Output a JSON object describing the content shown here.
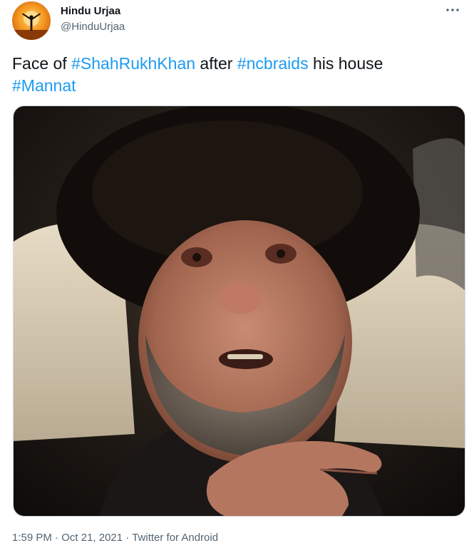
{
  "user": {
    "name": "Hindu Urjaa",
    "handle": "@HinduUrjaa",
    "avatar_icon": "orange-sunset-silhouette-avatar"
  },
  "tweet": {
    "text_before_1": "Face of ",
    "hashtag_1": "#ShahRukhKhan",
    "text_between_1": " after ",
    "hashtag_2": "#ncbraids",
    "text_between_2": " his house ",
    "hashtag_3": "#Mannat"
  },
  "media": {
    "icon": "photo-of-man-with-dark-hair-and-grey-beard-in-car"
  },
  "meta": {
    "time": "1:59 PM",
    "separator": " · ",
    "date": "Oct 21, 2021",
    "source": "Twitter for Android"
  },
  "icons": {
    "more": "more-options-icon"
  },
  "colors": {
    "link": "#1d9bf0",
    "text": "#0f1419",
    "secondary": "#536471"
  }
}
